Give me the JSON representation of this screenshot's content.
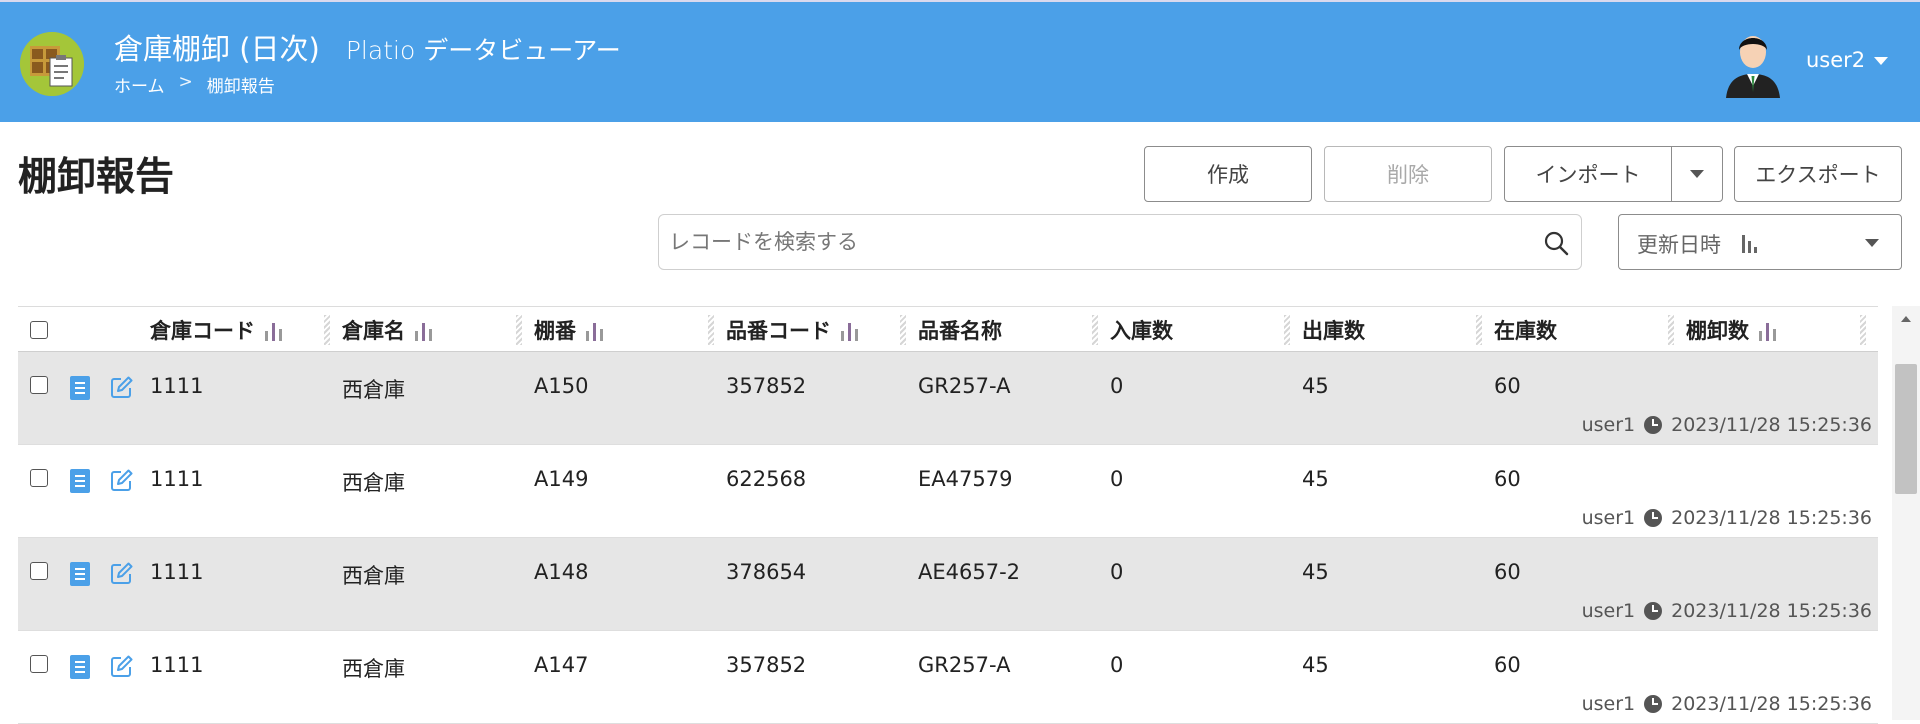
{
  "header": {
    "app_title": "倉庫棚卸 (日次)",
    "app_subtitle": "Platio データビューアー",
    "breadcrumb": {
      "home": "ホーム",
      "separator": ">",
      "current": "棚卸報告"
    },
    "user_name": "user2",
    "background_color": "#4ba0e8"
  },
  "toolbar": {
    "page_title": "棚卸報告",
    "create_label": "作成",
    "delete_label": "削除",
    "import_label": "インポート",
    "export_label": "エクスポート",
    "search_placeholder": "レコードを検索する",
    "sort_label": "更新日時"
  },
  "table": {
    "columns": [
      {
        "label": "倉庫コード",
        "sort_icon": true
      },
      {
        "label": "倉庫名",
        "sort_icon": true
      },
      {
        "label": "棚番",
        "sort_icon": true
      },
      {
        "label": "品番コード",
        "sort_icon": true
      },
      {
        "label": "品番名称",
        "sort_icon": false
      },
      {
        "label": "入庫数",
        "sort_icon": false
      },
      {
        "label": "出庫数",
        "sort_icon": false
      },
      {
        "label": "在庫数",
        "sort_icon": false
      },
      {
        "label": "棚卸数",
        "sort_icon": true
      }
    ],
    "rows": [
      {
        "cells": [
          "1111",
          "西倉庫",
          "A150",
          "357852",
          "GR257-A",
          "0",
          "45",
          "60",
          ""
        ],
        "user": "user1",
        "timestamp": "2023/11/28 15:25:36"
      },
      {
        "cells": [
          "1111",
          "西倉庫",
          "A149",
          "622568",
          "EA47579",
          "0",
          "45",
          "60",
          ""
        ],
        "user": "user1",
        "timestamp": "2023/11/28 15:25:36"
      },
      {
        "cells": [
          "1111",
          "西倉庫",
          "A148",
          "378654",
          "AE4657-2",
          "0",
          "45",
          "60",
          ""
        ],
        "user": "user1",
        "timestamp": "2023/11/28 15:25:36"
      },
      {
        "cells": [
          "1111",
          "西倉庫",
          "A147",
          "357852",
          "GR257-A",
          "0",
          "45",
          "60",
          ""
        ],
        "user": "user1",
        "timestamp": "2023/11/28 15:25:36"
      }
    ]
  },
  "icons": {
    "app": "warehouse-clipboard-icon",
    "avatar": "user-avatar-icon",
    "search": "search-icon",
    "sort": "bar-chart-icon",
    "view": "document-icon",
    "edit": "edit-icon",
    "clock": "clock-icon"
  },
  "colors": {
    "accent": "#4ba0e8",
    "row_shade": "#e6e6e6",
    "icon_blue": "#4ba0e8"
  }
}
